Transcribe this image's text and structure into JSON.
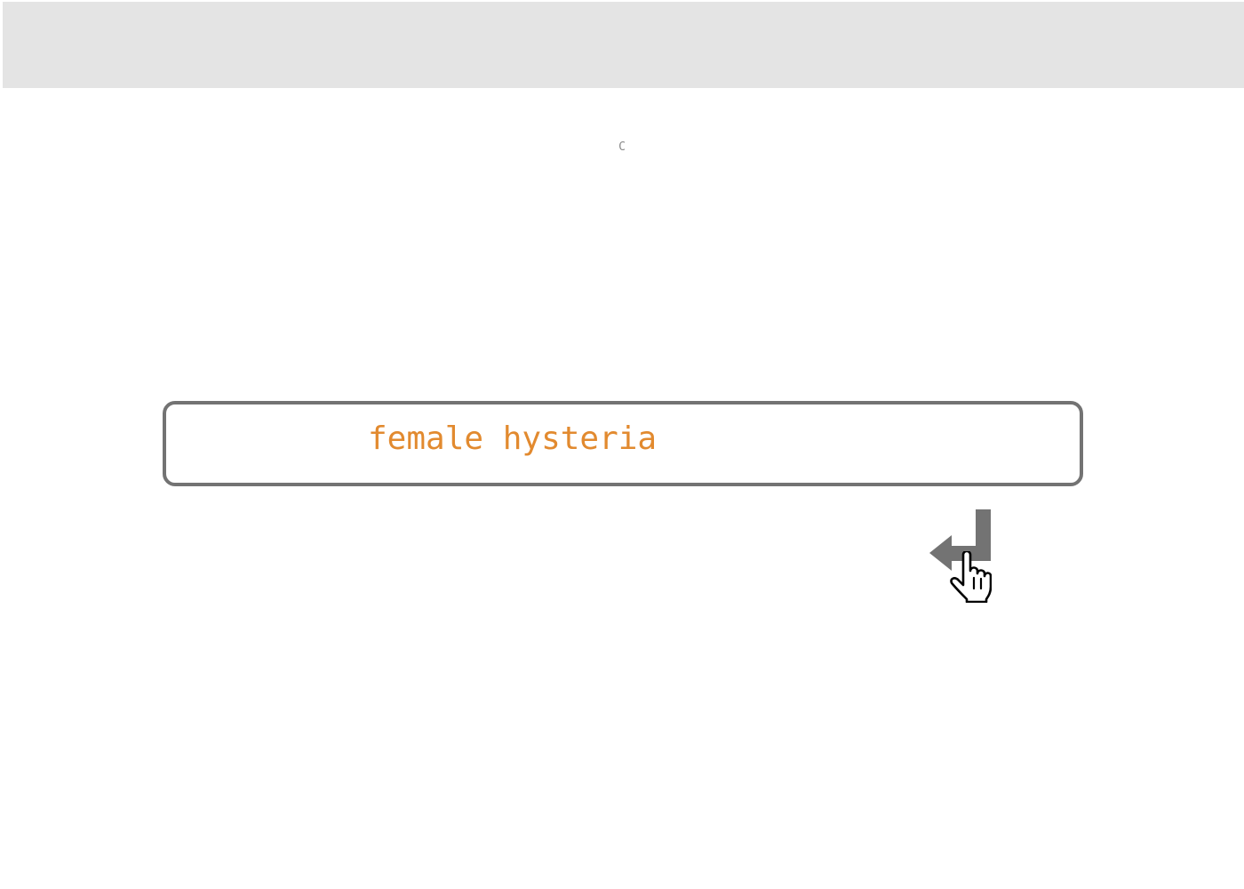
{
  "toolbar": {
    "background_color": "#e4e4e4"
  },
  "reload_indicator": {
    "text": "C",
    "icon": "reload-icon"
  },
  "search": {
    "value": "female hysteria",
    "text_color": "#e28a2f",
    "border_color": "#737373"
  },
  "enter_button": {
    "icon": "enter-return-icon",
    "color": "#737373"
  },
  "cursor": {
    "icon": "hand-pointer-icon"
  }
}
